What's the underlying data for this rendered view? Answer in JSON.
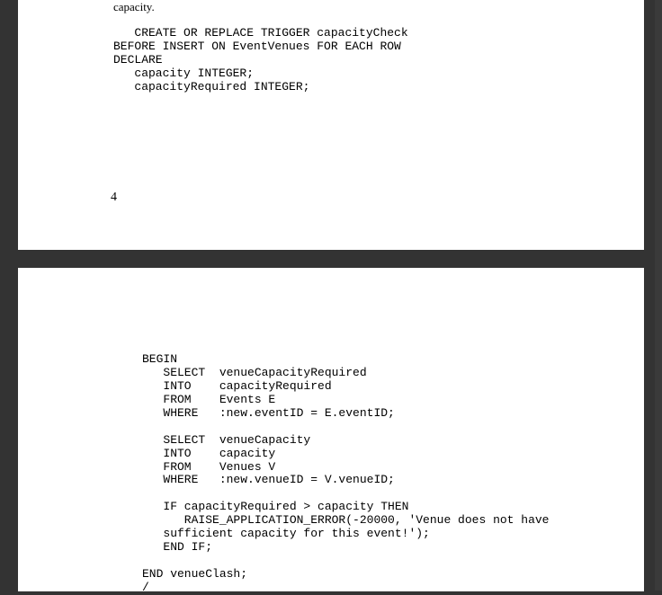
{
  "page1": {
    "caption": "capacity.",
    "code": "   CREATE OR REPLACE TRIGGER capacityCheck\nBEFORE INSERT ON EventVenues FOR EACH ROW\nDECLARE\n   capacity INTEGER;\n   capacityRequired INTEGER;",
    "pagenum": "4"
  },
  "page2": {
    "code": "BEGIN\n   SELECT  venueCapacityRequired\n   INTO    capacityRequired\n   FROM    Events E\n   WHERE   :new.eventID = E.eventID;\n\n   SELECT  venueCapacity\n   INTO    capacity\n   FROM    Venues V\n   WHERE   :new.venueID = V.venueID;\n\n   IF capacityRequired > capacity THEN\n      RAISE_APPLICATION_ERROR(-20000, 'Venue does not have\n   sufficient capacity for this event!');\n   END IF;\n\nEND venueClash;\n/"
  }
}
